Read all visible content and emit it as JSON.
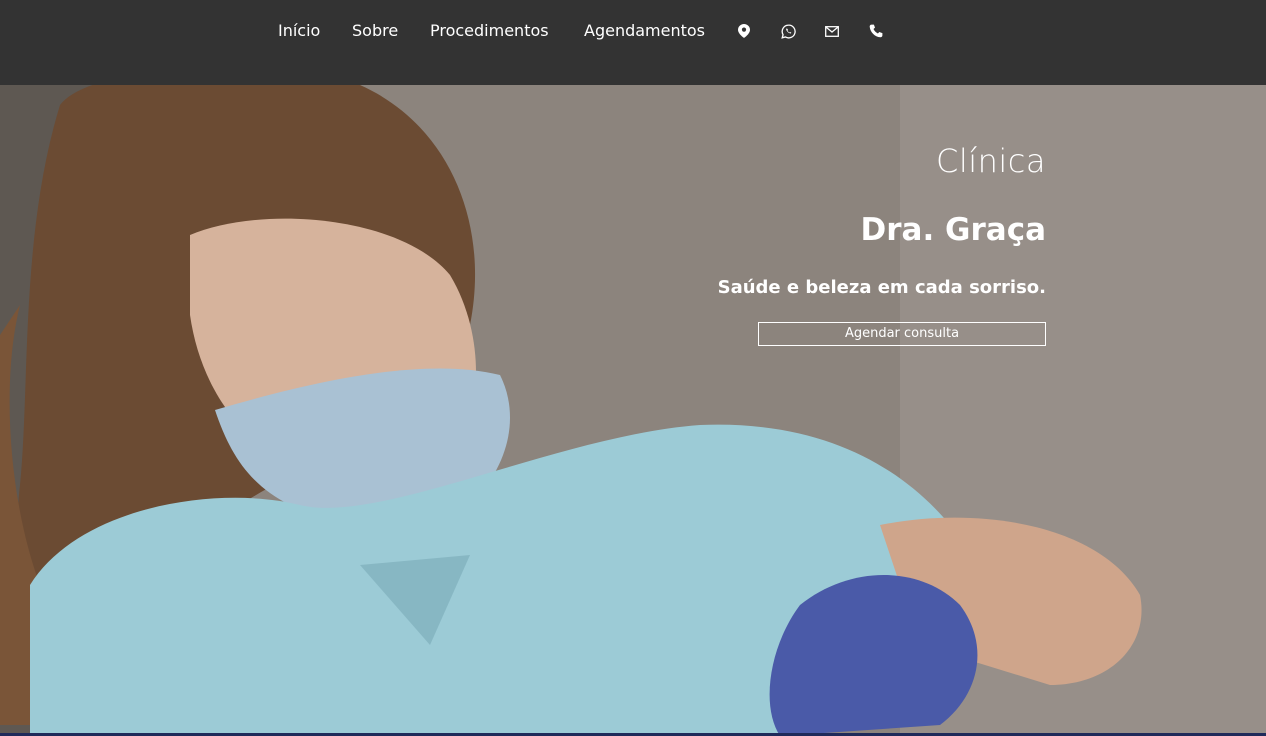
{
  "nav": {
    "items": [
      {
        "label": "Início"
      },
      {
        "label": "Sobre"
      },
      {
        "label": "Procedimentos"
      },
      {
        "label": "Agendamentos"
      }
    ],
    "icons": [
      "map-pin-icon",
      "whatsapp-icon",
      "email-icon",
      "phone-icon"
    ]
  },
  "hero": {
    "eyebrow": "Clínica",
    "title": "Dra. Graça",
    "tagline": "Saúde e beleza em cada sorriso.",
    "cta_label": "Agendar consulta"
  },
  "colors": {
    "topbar": "#333333",
    "text": "#ffffff",
    "scrubs": "#9ccbd6",
    "glove": "#4a5aa8"
  }
}
